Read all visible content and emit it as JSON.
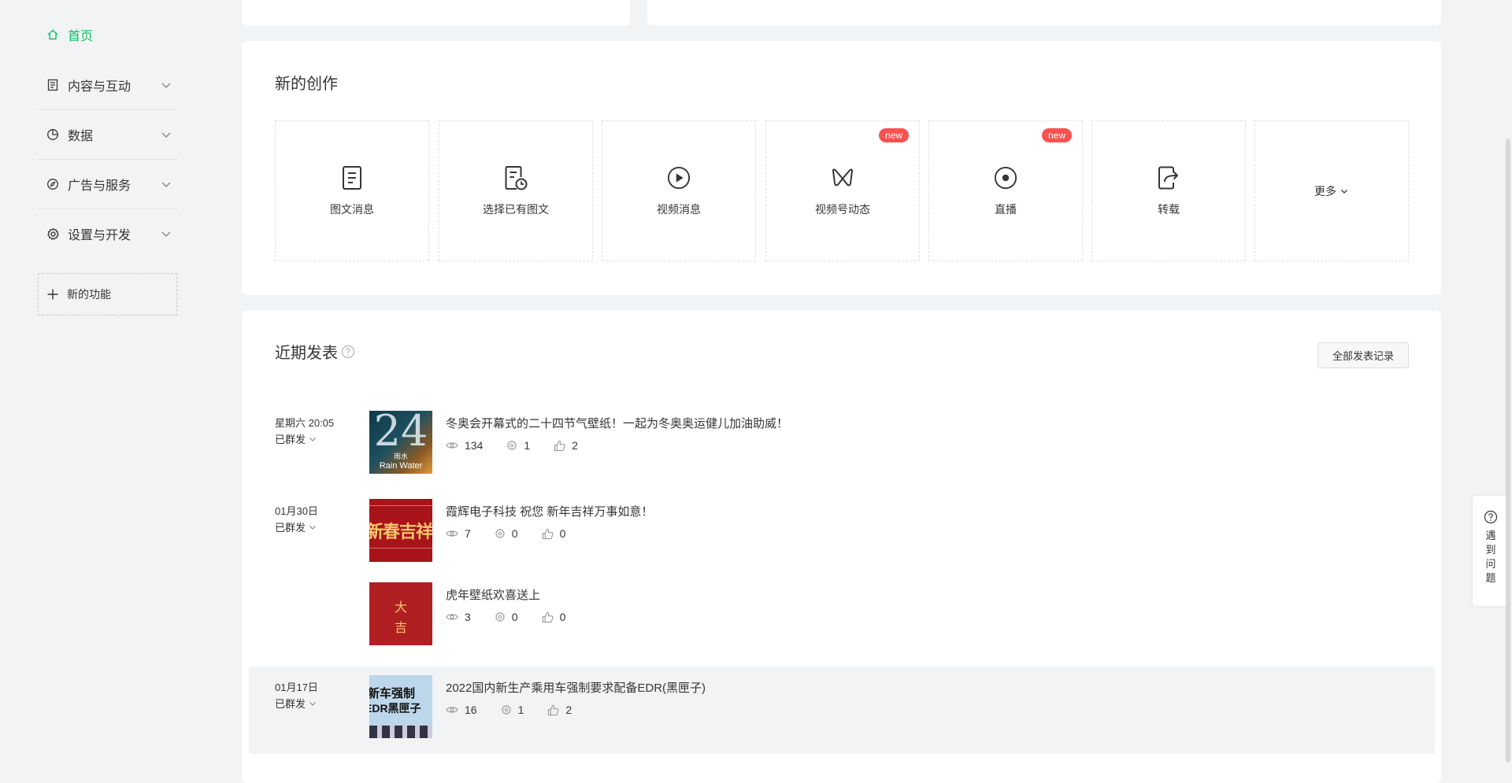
{
  "sidebar": {
    "home": "首页",
    "items": [
      {
        "label": "内容与互动",
        "icon": "document-icon"
      },
      {
        "label": "数据",
        "icon": "pie-chart-icon"
      },
      {
        "label": "广告与服务",
        "icon": "compass-icon"
      },
      {
        "label": "设置与开发",
        "icon": "gear-icon"
      }
    ],
    "new_feature": "新的功能"
  },
  "create": {
    "title": "新的创作",
    "tiles": [
      {
        "label": "图文消息",
        "icon": "article-icon"
      },
      {
        "label": "选择已有图文",
        "icon": "article-history-icon"
      },
      {
        "label": "视频消息",
        "icon": "play-icon"
      },
      {
        "label": "视频号动态",
        "icon": "channels-icon",
        "badge": "new"
      },
      {
        "label": "直播",
        "icon": "live-icon",
        "badge": "new"
      },
      {
        "label": "转载",
        "icon": "share-icon"
      }
    ],
    "more": "更多"
  },
  "recent": {
    "title": "近期发表",
    "all_button": "全部发表记录",
    "groups": [
      {
        "date": "星期六 20:05",
        "status": "已群发"
      },
      {
        "date": "01月30日",
        "status": "已群发"
      },
      {
        "date": "01月17日",
        "status": "已群发"
      }
    ],
    "posts": [
      {
        "title": "冬奥会开幕式的二十四节气壁纸！一起为冬奥奥运健儿加油助威！",
        "views": "134",
        "shares": "1",
        "likes": "2",
        "thumb_text_main": "24",
        "thumb_text_a": "雨水",
        "thumb_text_b": "Rain Water"
      },
      {
        "title": "霞辉电子科技 祝您 新年吉祥万事如意！",
        "views": "7",
        "shares": "0",
        "likes": "0",
        "thumb_text_main": "新春吉祥"
      },
      {
        "title": "虎年壁纸欢喜送上",
        "views": "3",
        "shares": "0",
        "likes": "0",
        "thumb_text_a": "大",
        "thumb_text_b": "吉"
      },
      {
        "title": "2022国内新生产乘用车强制要求配备EDR(黑匣子)",
        "views": "16",
        "shares": "1",
        "likes": "2",
        "thumb_text_a": "新车强制",
        "thumb_text_b": "EDR黑匣子"
      }
    ]
  },
  "help": {
    "label": "遇到问题"
  },
  "colors": {
    "accent": "#07c160",
    "badge": "#fa5151"
  }
}
